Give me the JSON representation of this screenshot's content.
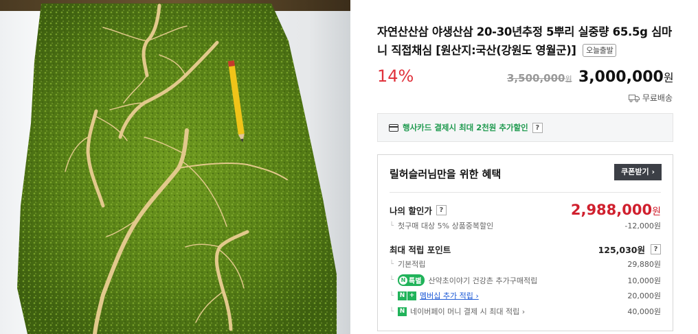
{
  "product": {
    "title": "자연산산삼 야생산삼 20-30년추정 5뿌리 실중량 65.5g 심마니 직접채심 [원산지:국산(강원도 영월군)]",
    "badge": "오늘출발",
    "discount": "14%",
    "original_price": "3,500,000",
    "original_price_unit": "원",
    "price": "3,000,000",
    "price_unit": "원",
    "shipping": "무료배송"
  },
  "card_banner": {
    "text": "행사카드 결제시 최대 2천원 추가할인",
    "help": "?"
  },
  "benefit": {
    "header": "릴허슬러님만을 위한 혜택",
    "coupon_button": "쿠폰받기 ›",
    "my_price_label": "나의 할인가",
    "my_price_help": "?",
    "my_price": "2,988,000",
    "my_price_unit": "원",
    "first_buy_label": "첫구매 대상 5% 상품중복할인",
    "first_buy_value": "-12,000원",
    "points_label": "최대 적립 포인트",
    "points_value": "125,030원",
    "points_help": "?",
    "rows": [
      {
        "label": "기본적립",
        "value": "29,880원"
      },
      {
        "badge": "특별",
        "label": "산약초이야기 건강촌 추가구매적립",
        "value": "10,000원"
      },
      {
        "badge": "N+",
        "label": "멤버십 추가 적립 ›",
        "value": "20,000원"
      },
      {
        "badge": "N",
        "label": "네이버페이 머니 결제 시 최대 적립 ›",
        "value": "40,000원"
      }
    ]
  },
  "colors": {
    "discount": "#e0323c",
    "my_price": "#d0202e",
    "naver_green": "#21b35a",
    "link_blue": "#1a58d6"
  },
  "icons": [
    "truck-icon",
    "card-icon",
    "naver-pay-icon"
  ]
}
